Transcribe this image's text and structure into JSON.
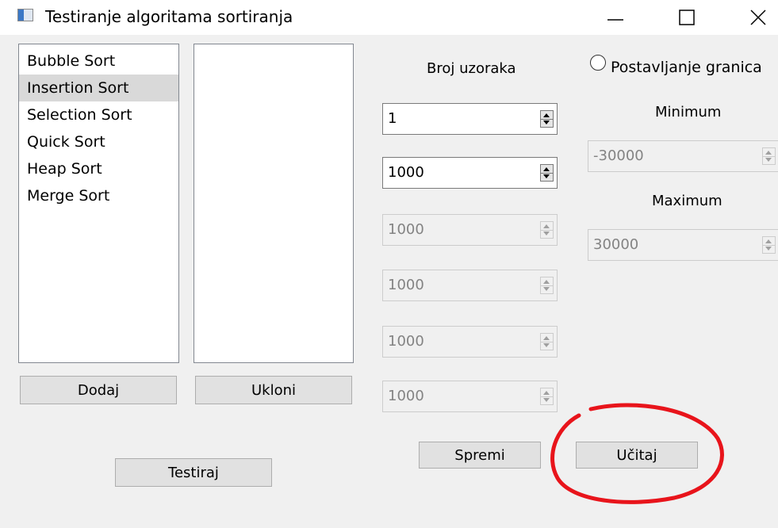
{
  "window": {
    "title": "Testiranje algoritama sortiranja",
    "icons": {
      "app": "app-icon",
      "minimize": "minimize-icon",
      "maximize": "maximize-icon",
      "close": "close-icon"
    }
  },
  "algorithms": {
    "items": [
      "Bubble Sort",
      "Insertion Sort",
      "Selection Sort",
      "Quick Sort",
      "Heap Sort",
      "Merge Sort"
    ],
    "selected": "Insertion Sort"
  },
  "selected_algorithms": {
    "items": []
  },
  "buttons": {
    "add": "Dodaj",
    "remove": "Ukloni",
    "test": "Testiraj",
    "save": "Spremi",
    "load": "Učitaj"
  },
  "samples": {
    "label": "Broj uzoraka",
    "fields": [
      {
        "value": "1",
        "enabled": true
      },
      {
        "value": "1000",
        "enabled": true
      },
      {
        "value": "1000",
        "enabled": false
      },
      {
        "value": "1000",
        "enabled": false
      },
      {
        "value": "1000",
        "enabled": false
      },
      {
        "value": "1000",
        "enabled": false
      }
    ]
  },
  "bounds": {
    "radio_label": "Postavljanje granica",
    "checked": false,
    "min_label": "Minimum",
    "min_value": "-30000",
    "max_label": "Maximum",
    "max_value": "30000"
  },
  "colors": {
    "annotation": "#e8141b",
    "selection": "#d9d9d9"
  }
}
